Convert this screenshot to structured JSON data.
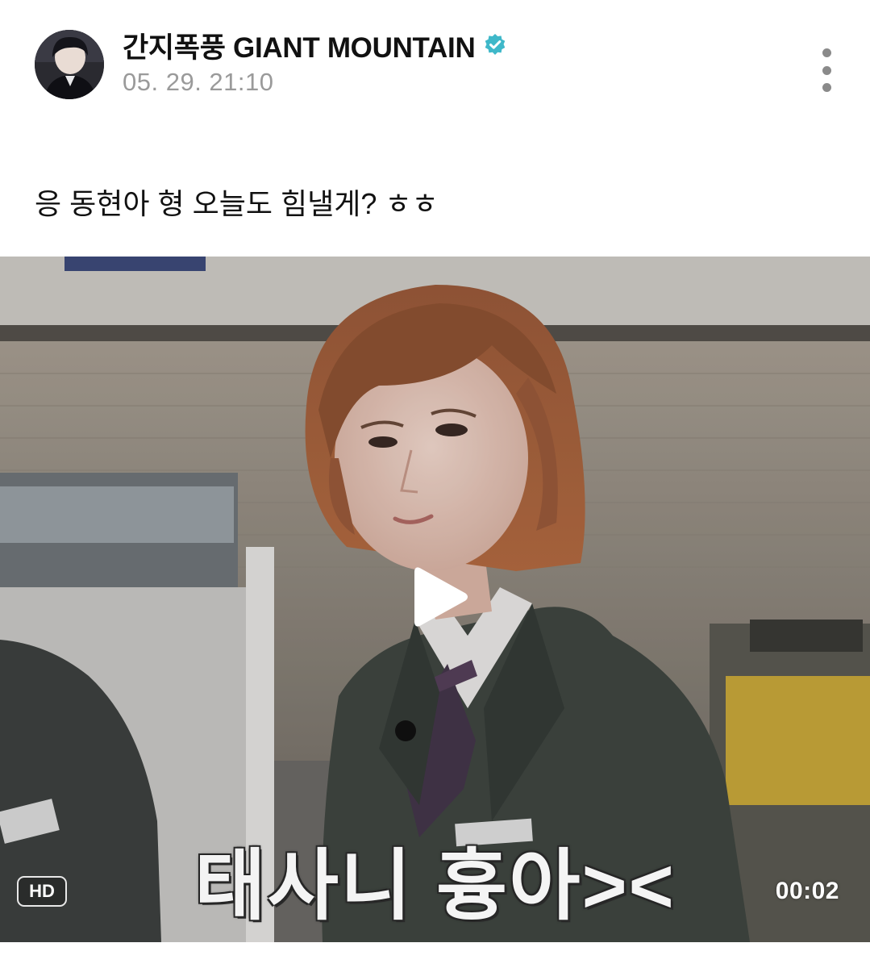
{
  "post": {
    "author_name": "간지폭풍 GIANT MOUNTAIN",
    "verified_icon": "verified-badge-icon",
    "timestamp": "05. 29. 21:10",
    "more_icon": "more-vertical-icon",
    "text": "응 동현아 형 오늘도 힘낼게? ㅎㅎ"
  },
  "video": {
    "subtitle": "태사니 흉아><",
    "quality_badge": "HD",
    "duration": "00:02",
    "play_icon": "play-icon"
  },
  "colors": {
    "verified": "#3fb8c9",
    "timestamp": "#9a9a9a",
    "text": "#111111"
  }
}
